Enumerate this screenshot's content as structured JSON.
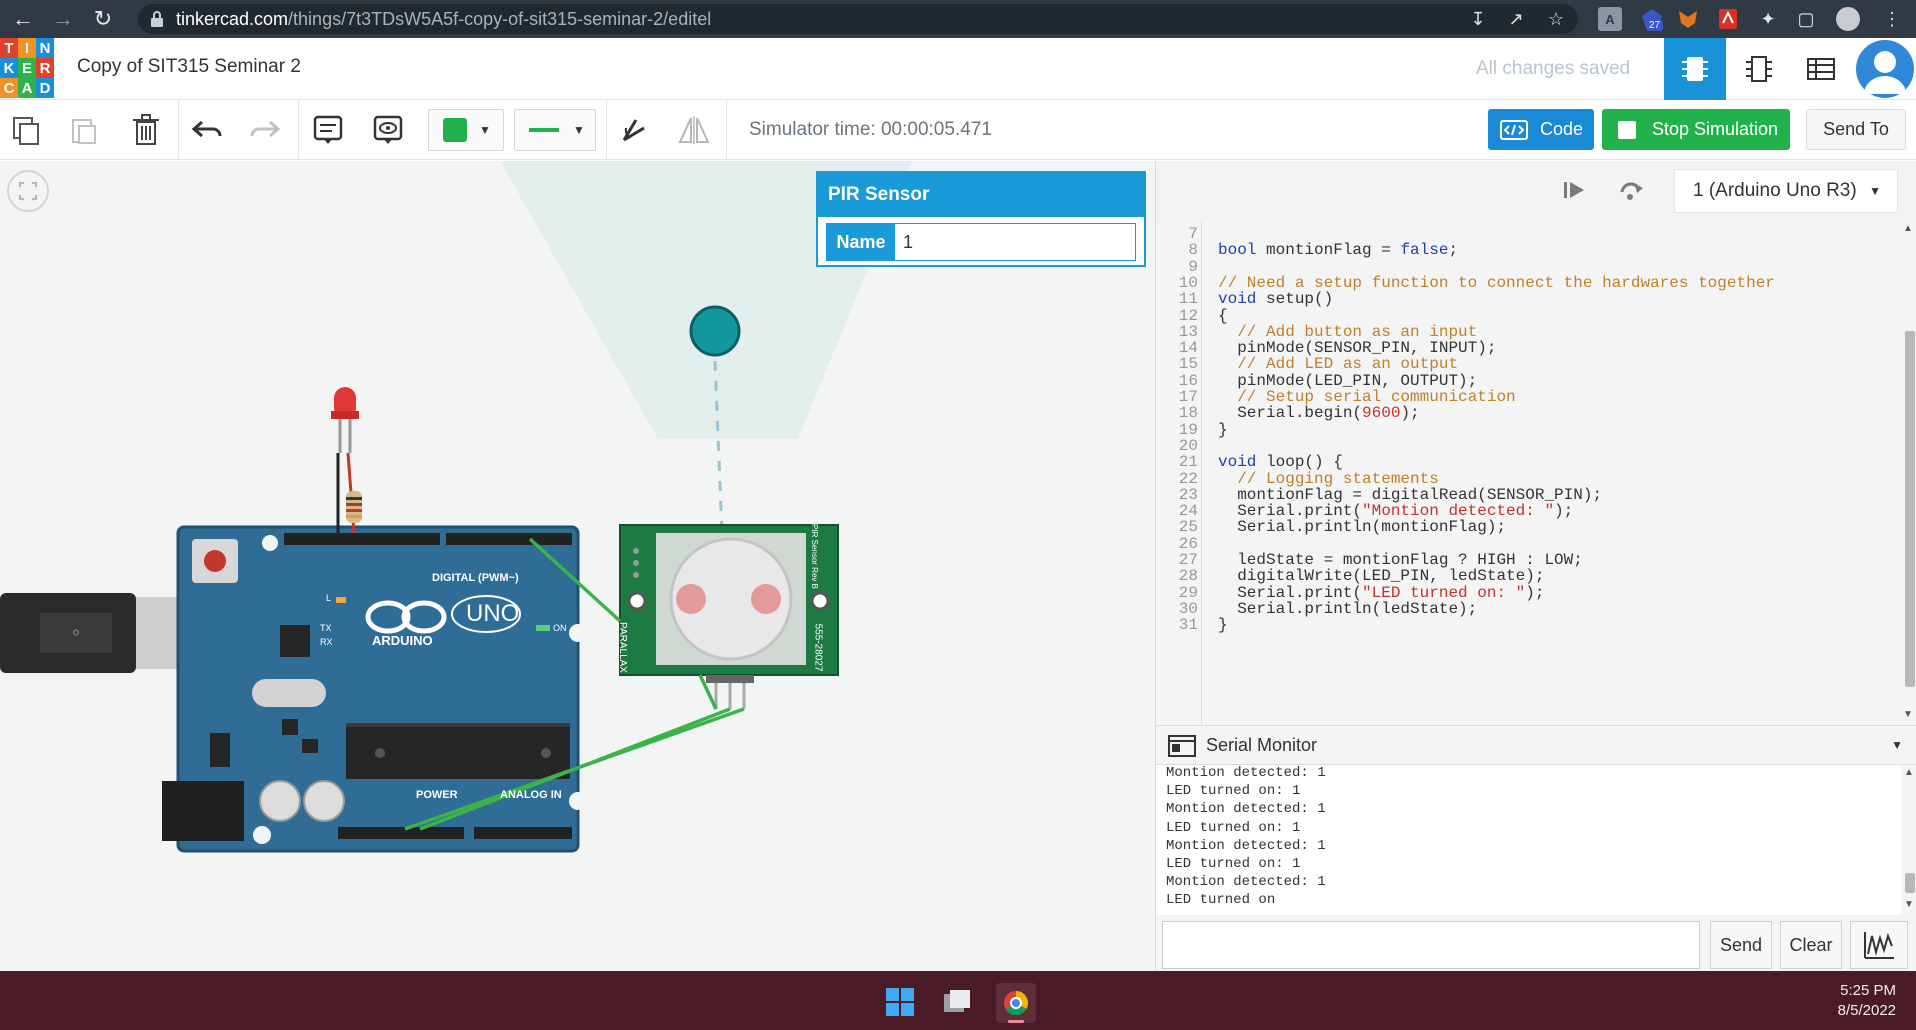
{
  "browser": {
    "url_host": "tinkercad.com",
    "url_path": "/things/7t3TDsW5A5f-copy-of-sit315-seminar-2/editel",
    "ext_badge": "27"
  },
  "logo": {
    "letters": [
      "T",
      "I",
      "N",
      "K",
      "E",
      "R",
      "C",
      "A",
      "D"
    ]
  },
  "header": {
    "title": "Copy of SIT315 Seminar 2",
    "save_status": "All changes saved"
  },
  "toolbar": {
    "sim_time": "Simulator time: 00:00:05.471",
    "code_label": "Code",
    "stop_label": "Stop Simulation",
    "send_to_label": "Send To"
  },
  "pir_panel": {
    "title": "PIR Sensor",
    "name_label": "Name",
    "name_value": "1"
  },
  "board": {
    "label_digital": "DIGITAL (PWM~)",
    "label_arduino": "ARDUINO",
    "label_uno": "UNO",
    "label_power": "POWER",
    "label_analog": "ANALOG IN",
    "label_on": "ON",
    "label_tx": "TX",
    "label_rx": "RX",
    "label_l": "L",
    "sensor_parallax": "PARALLAX",
    "sensor_model": "555-28027",
    "sensor_title": "PIR Sensor Rev B"
  },
  "right_panel": {
    "device": "1 (Arduino Uno R3)"
  },
  "code": [
    {
      "n": "7",
      "parts": []
    },
    {
      "n": "8",
      "parts": [
        [
          "kw",
          "bool"
        ],
        [
          "p",
          " montionFlag = "
        ],
        [
          "kw",
          "false"
        ],
        [
          "p",
          ";"
        ]
      ]
    },
    {
      "n": "9",
      "parts": []
    },
    {
      "n": "10",
      "parts": [
        [
          "cm",
          "// Need a setup function to connect the hardwares together"
        ]
      ]
    },
    {
      "n": "11",
      "parts": [
        [
          "kw",
          "void"
        ],
        [
          "p",
          " setup()"
        ]
      ]
    },
    {
      "n": "12",
      "parts": [
        [
          "p",
          "{"
        ]
      ]
    },
    {
      "n": "13",
      "parts": [
        [
          "cm",
          "  // Add button as an input"
        ]
      ]
    },
    {
      "n": "14",
      "parts": [
        [
          "p",
          "  pinMode(SENSOR_PIN, INPUT);"
        ]
      ]
    },
    {
      "n": "15",
      "parts": [
        [
          "cm",
          "  // Add LED as an output"
        ]
      ]
    },
    {
      "n": "16",
      "parts": [
        [
          "p",
          "  pinMode(LED_PIN, OUTPUT);"
        ]
      ]
    },
    {
      "n": "17",
      "parts": [
        [
          "cm",
          "  // Setup serial communication"
        ]
      ]
    },
    {
      "n": "18",
      "parts": [
        [
          "p",
          "  Serial.begin("
        ],
        [
          "st",
          "9600"
        ],
        [
          "p",
          ");"
        ]
      ]
    },
    {
      "n": "19",
      "parts": [
        [
          "p",
          "}"
        ]
      ]
    },
    {
      "n": "20",
      "parts": []
    },
    {
      "n": "21",
      "parts": [
        [
          "kw",
          "void"
        ],
        [
          "p",
          " loop() {"
        ]
      ]
    },
    {
      "n": "22",
      "parts": [
        [
          "cm",
          "  // Logging statements"
        ]
      ]
    },
    {
      "n": "23",
      "parts": [
        [
          "p",
          "  montionFlag = digitalRead(SENSOR_PIN);"
        ]
      ]
    },
    {
      "n": "24",
      "parts": [
        [
          "p",
          "  Serial.print("
        ],
        [
          "st",
          "\"Montion detected: \""
        ],
        [
          "p",
          ");"
        ]
      ]
    },
    {
      "n": "25",
      "parts": [
        [
          "p",
          "  Serial.println(montionFlag);"
        ]
      ]
    },
    {
      "n": "26",
      "parts": []
    },
    {
      "n": "27",
      "parts": [
        [
          "p",
          "  ledState = montionFlag ? HIGH : LOW;"
        ]
      ]
    },
    {
      "n": "28",
      "parts": [
        [
          "p",
          "  digitalWrite(LED_PIN, ledState);"
        ]
      ]
    },
    {
      "n": "29",
      "parts": [
        [
          "p",
          "  Serial.print("
        ],
        [
          "st",
          "\"LED turned on: \""
        ],
        [
          "p",
          ");"
        ]
      ]
    },
    {
      "n": "30",
      "parts": [
        [
          "p",
          "  Serial.println(ledState);"
        ]
      ]
    },
    {
      "n": "31",
      "parts": [
        [
          "p",
          "}"
        ]
      ]
    }
  ],
  "serial_monitor": {
    "title": "Serial Monitor",
    "lines": [
      "Montion detected: 1",
      "LED turned on: 1",
      "Montion detected: 1",
      "LED turned on: 1",
      "Montion detected: 1",
      "LED turned on: 1",
      "Montion detected: 1",
      "LED turned on"
    ],
    "input_value": "",
    "send_label": "Send",
    "clear_label": "Clear"
  },
  "taskbar": {
    "time": "5:25 PM",
    "date": "8/5/2022"
  }
}
